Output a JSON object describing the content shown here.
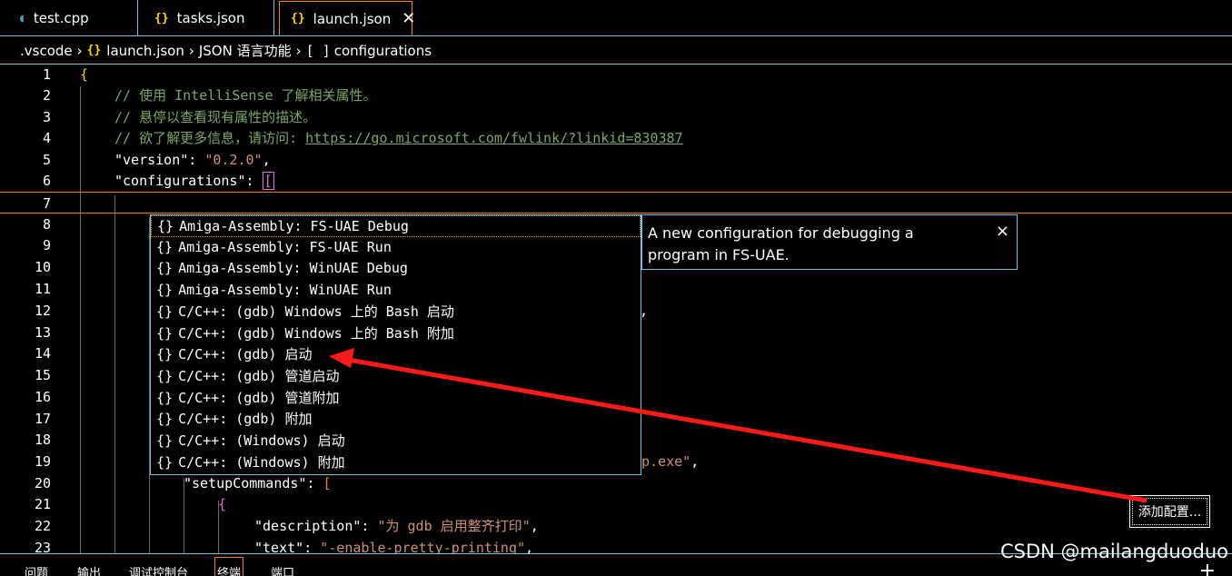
{
  "tabs": [
    {
      "label": "test.cpp",
      "icon": "C",
      "icon_color": "#519aba"
    },
    {
      "label": "tasks.json",
      "icon": "{}",
      "icon_color": "#ffd700"
    },
    {
      "label": "launch.json",
      "icon": "{}",
      "icon_color": "#ffd700",
      "active": true
    }
  ],
  "breadcrumb": {
    "folder": ".vscode",
    "file": "launch.json",
    "section": "JSON 语言功能",
    "item": "configurations"
  },
  "editor": {
    "line_numbers": [
      "1",
      "2",
      "3",
      "4",
      "5",
      "6",
      "7",
      "8",
      "9",
      "10",
      "11",
      "12",
      "13",
      "14",
      "15",
      "16",
      "17",
      "18",
      "19",
      "20",
      "21",
      "22",
      "23"
    ],
    "lines": {
      "l1": "{",
      "l2": "// 使用 IntelliSense 了解相关属性。",
      "l3": "// 悬停以查看现有属性的描述。",
      "l4_prefix": "// 欲了解更多信息，请访问: ",
      "l4_link": "https://go.microsoft.com/fwlink/?linkid=830387",
      "l5_key": "\"version\"",
      "l5_val": "\"0.2.0\"",
      "l6_key": "\"configurations\"",
      "l6_bracket": "[",
      "l12_tail": ",",
      "l19_tail_str": "p.exe\"",
      "l19_tail_comma": ",",
      "l20_key": "\"setupCommands\"",
      "l20_bracket": "[",
      "l21": "{",
      "l22_key": "\"description\"",
      "l22_val": "\"为 gdb 启用整齐打印\"",
      "l23_key": "\"text\"",
      "l23_val": "\"-enable-pretty-printing\""
    }
  },
  "suggest": {
    "icon": "{}",
    "items": [
      "Amiga-Assembly: FS-UAE Debug",
      "Amiga-Assembly: FS-UAE Run",
      "Amiga-Assembly: WinUAE Debug",
      "Amiga-Assembly: WinUAE Run",
      "C/C++: (gdb) Windows 上的 Bash 启动",
      "C/C++: (gdb) Windows 上的 Bash 附加",
      "C/C++: (gdb) 启动",
      "C/C++: (gdb) 管道启动",
      "C/C++: (gdb) 管道附加",
      "C/C++: (gdb) 附加",
      "C/C++: (Windows) 启动",
      "C/C++: (Windows) 附加"
    ],
    "selected_index": 0
  },
  "details": {
    "text": "A new configuration for debugging a program in FS-UAE.",
    "close": "×"
  },
  "add_config_label": "添加配置...",
  "panel": {
    "tabs": [
      "问题",
      "输出",
      "调试控制台",
      "终端",
      "端口"
    ],
    "active_index": 3,
    "plus": "+"
  },
  "watermark": "CSDN @mailangduoduo",
  "colors": {
    "accent_border": "#6fc3df",
    "focus_border": "#f38518",
    "annotation_arrow": "#ff1a1a"
  }
}
